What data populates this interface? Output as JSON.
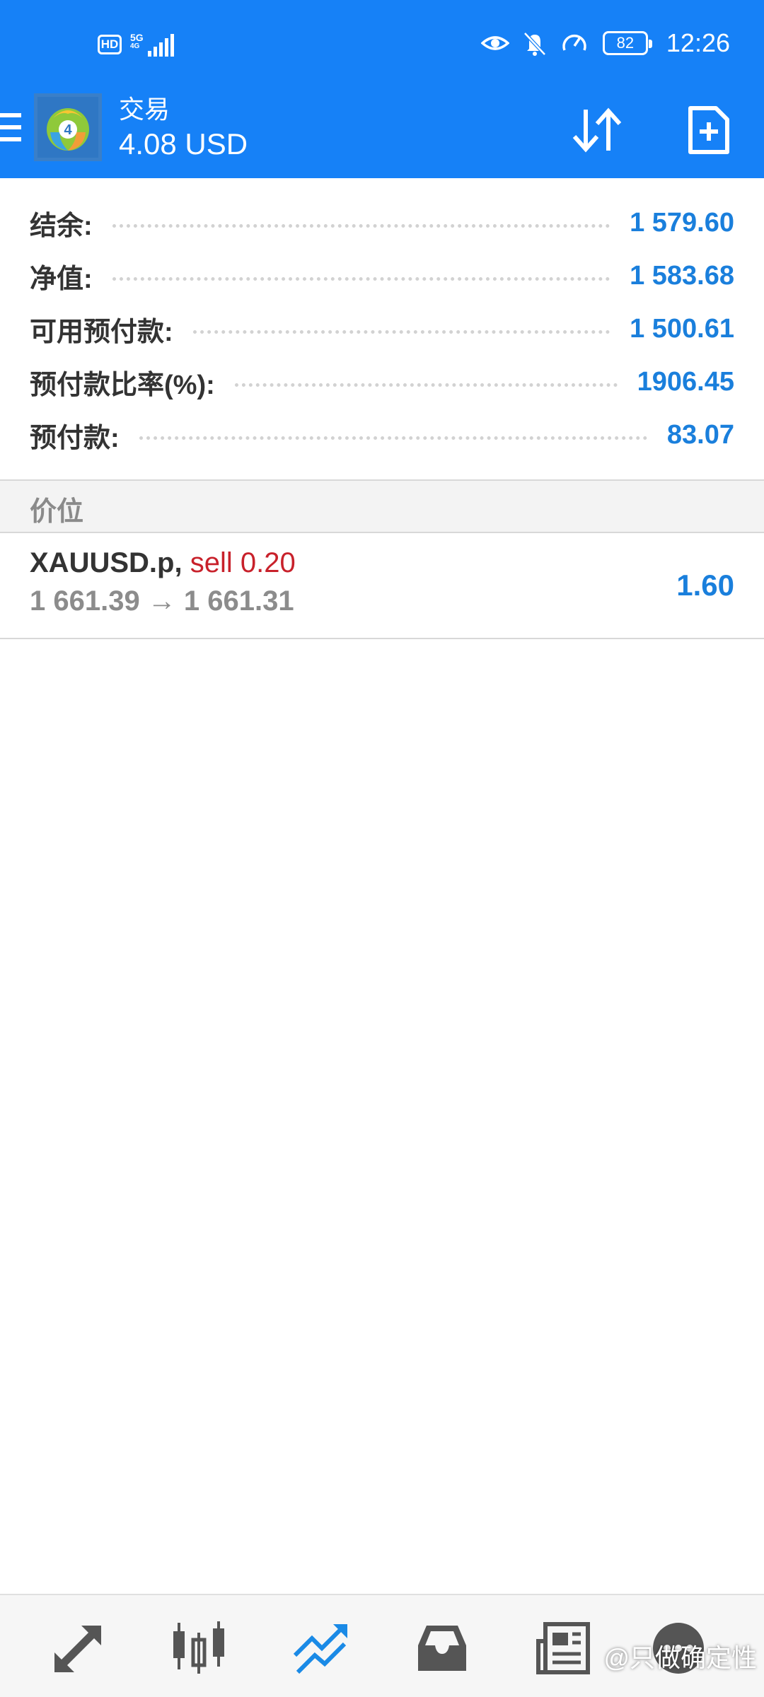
{
  "status_bar": {
    "hd": "HD",
    "net_type": "5G",
    "net_sub": "4G",
    "battery": "82",
    "time": "12:26"
  },
  "header": {
    "title": "交易",
    "subtitle": "4.08 USD",
    "logo_letter": "4"
  },
  "account": [
    {
      "label": "结余:",
      "value": "1 579.60"
    },
    {
      "label": "净值:",
      "value": "1 583.68"
    },
    {
      "label": "可用预付款:",
      "value": "1 500.61"
    },
    {
      "label": "预付款比率(%):",
      "value": "1906.45"
    },
    {
      "label": "预付款:",
      "value": "83.07"
    }
  ],
  "positions_section": {
    "label": "价位"
  },
  "position": {
    "symbol": "XAUUSD.p,",
    "side": "sell 0.20",
    "prices": "1 661.39 → 1 661.31",
    "profit": "1.60"
  },
  "watermark": "@只做确定性",
  "colors": {
    "brand": "#1681f7",
    "value_blue": "#1a7fdc",
    "sell_red": "#c8212b"
  },
  "bottom_nav": {
    "items": [
      "quotes-icon",
      "chart-icon",
      "trade-icon",
      "history-icon",
      "news-icon",
      "chat-icon"
    ],
    "active": "trade-icon"
  }
}
